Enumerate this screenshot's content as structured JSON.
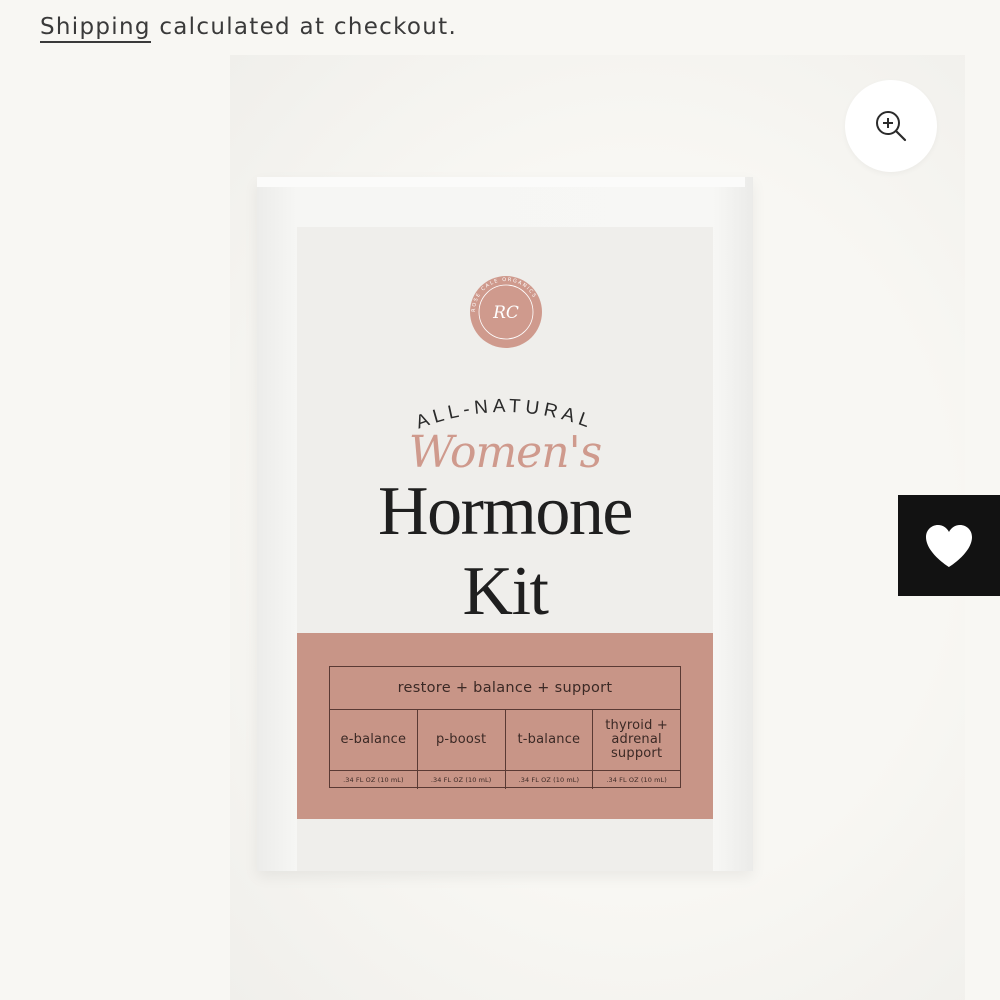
{
  "shipping": {
    "link_label": "Shipping",
    "rest_text": " calculated at checkout."
  },
  "zoom": {
    "icon": "zoom-in-icon"
  },
  "wishlist": {
    "icon": "heart-icon"
  },
  "product_image": {
    "logo_initials": "RC",
    "logo_ring_text": "ROSE CALE ORGANICS",
    "curved_title": "ALL-NATURAL",
    "script_title": "Women's",
    "main_title_line1": "Hormone",
    "main_title_line2": "Kit",
    "table_header": "restore + balance + support",
    "products": [
      {
        "name_line1": "e-balance",
        "name_line2": "",
        "name_line3": "",
        "size": ".34 FL OZ (10 mL)"
      },
      {
        "name_line1": "p-boost",
        "name_line2": "",
        "name_line3": "",
        "size": ".34 FL OZ (10 mL)"
      },
      {
        "name_line1": "t-balance",
        "name_line2": "",
        "name_line3": "",
        "size": ".34 FL OZ (10 mL)"
      },
      {
        "name_line1": "thyroid +",
        "name_line2": "adrenal",
        "name_line3": "support",
        "size": ".34 FL OZ (10 mL)"
      }
    ],
    "colors": {
      "accent_rose": "#c89587",
      "script_pink": "#cf9a8d",
      "label_cream": "#efeeeb"
    }
  }
}
